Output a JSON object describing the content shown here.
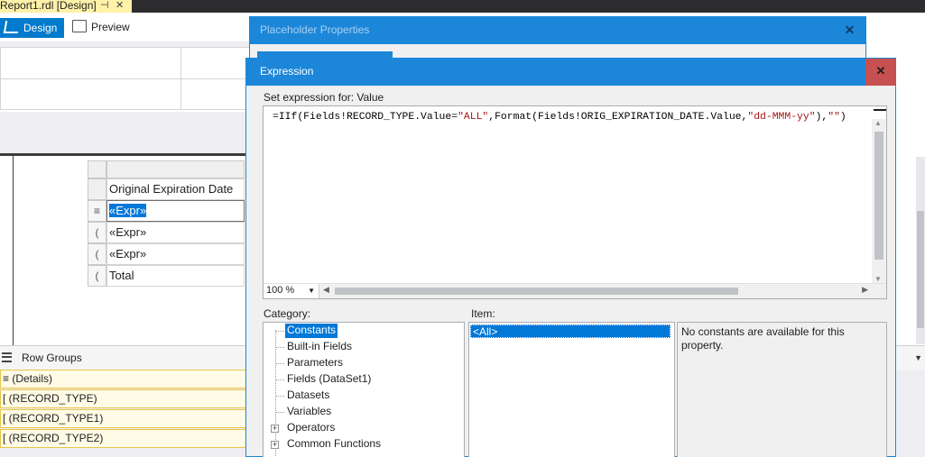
{
  "doc_tab": {
    "title": "Report1.rdl [Design]",
    "pin_glyph": "⊣",
    "close_glyph": "✕"
  },
  "toolbar": {
    "design_label": "Design",
    "preview_label": "Preview"
  },
  "tablix": {
    "header_text": "Original Expiration Date",
    "rows": [
      {
        "handle": "≡",
        "value": "«Expr»",
        "selected": true
      },
      {
        "handle": "(",
        "value": "«Expr»"
      },
      {
        "handle": "(",
        "value": "«Expr»"
      },
      {
        "handle": "(",
        "value": "Total"
      }
    ]
  },
  "row_groups": {
    "title": "Row Groups",
    "items": [
      "≡ (Details)",
      "[ (RECORD_TYPE)",
      "[ (RECORD_TYPE1)",
      "[ (RECORD_TYPE2)"
    ]
  },
  "placeholder_dialog": {
    "title": "Placeholder Properties",
    "close_glyph": "✕"
  },
  "expression_dialog": {
    "title": "Expression",
    "close_glyph": "✕",
    "set_label": "Set expression for: Value",
    "code": {
      "p1": "=IIf(Fields!RECORD_TYPE.Value=",
      "s1": "\"ALL\"",
      "p2": ",Format(Fields!ORIG_EXPIRATION_DATE.Value,",
      "s2": "\"dd-MMM-yy\"",
      "p3": "),",
      "s3": "\"\"",
      "p4": ")"
    },
    "zoom": "100 %",
    "category_label": "Category:",
    "item_label": "Item:",
    "categories": [
      {
        "label": "Constants",
        "selected": true,
        "expandable": false
      },
      {
        "label": "Built-in Fields",
        "expandable": false
      },
      {
        "label": "Parameters",
        "expandable": false
      },
      {
        "label": "Fields (DataSet1)",
        "expandable": false
      },
      {
        "label": "Datasets",
        "expandable": false
      },
      {
        "label": "Variables",
        "expandable": false
      },
      {
        "label": "Operators",
        "expandable": true
      },
      {
        "label": "Common Functions",
        "expandable": true
      }
    ],
    "items": [
      "<All>"
    ],
    "description": "No constants are available for this property."
  }
}
